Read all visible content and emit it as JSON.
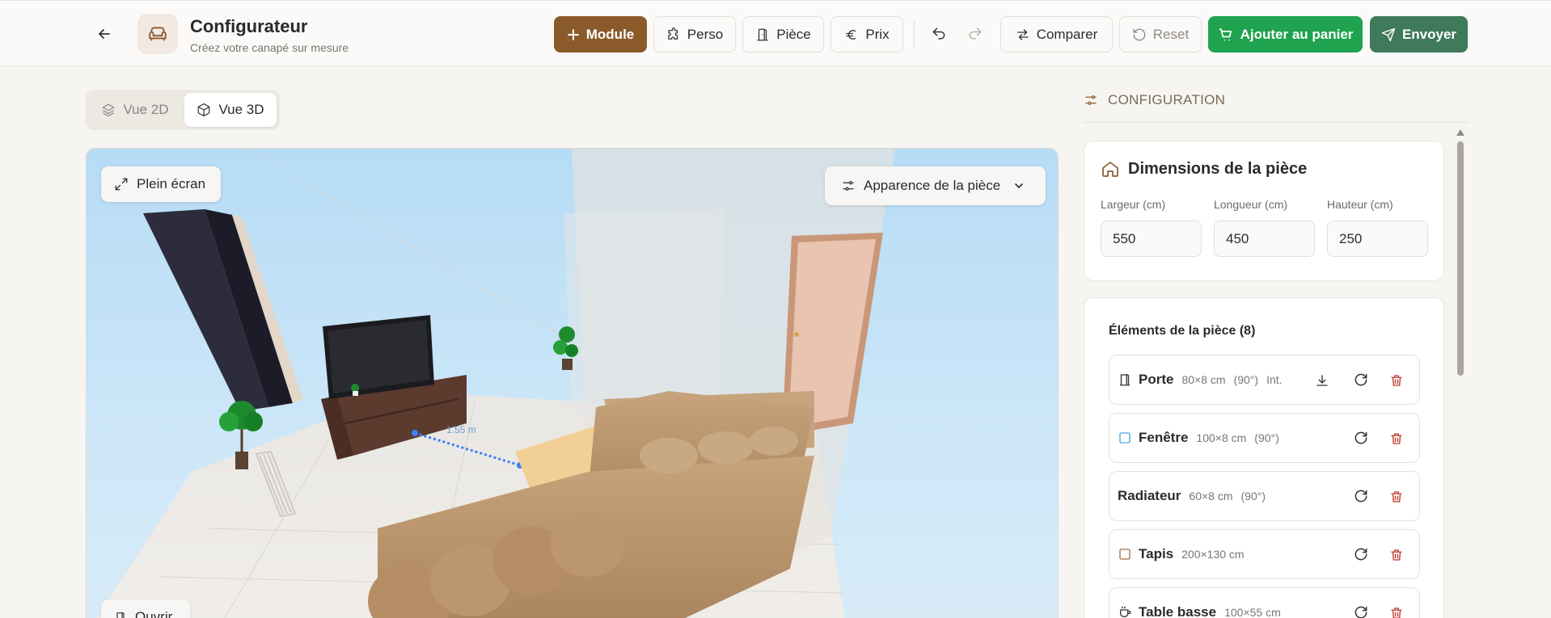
{
  "header": {
    "title": "Configurateur",
    "subtitle": "Créez votre canapé sur mesure",
    "module_label": "Module",
    "perso_label": "Perso",
    "piece_label": "Pièce",
    "prix_label": "Prix",
    "comparer_label": "Comparer",
    "reset_label": "Reset",
    "cart_label": "Ajouter au panier",
    "send_label": "Envoyer",
    "icons": [
      "arrow-left-icon",
      "sofa-icon",
      "plus-icon",
      "puzzle-icon",
      "door-icon",
      "euro-icon",
      "undo-icon",
      "redo-icon",
      "swap-icon",
      "reset-icon",
      "cart-icon",
      "send-icon"
    ]
  },
  "view_toggle": {
    "view_2d": "Vue 2D",
    "view_3d": "Vue 3D",
    "active": "Vue 3D"
  },
  "viewport": {
    "fullscreen_label": "Plein écran",
    "appearance_label": "Apparence de la pièce",
    "open_label": "Ouvrir",
    "measurement_label": "1.55 m"
  },
  "config": {
    "heading": "CONFIGURATION",
    "dimensions": {
      "title": "Dimensions de la pièce",
      "largeur_label": "Largeur (cm)",
      "largeur_value": "550",
      "longueur_label": "Longueur (cm)",
      "longueur_value": "450",
      "hauteur_label": "Hauteur (cm)",
      "hauteur_value": "250"
    },
    "elements": {
      "title": "Éléments de la pièce (8)",
      "items": [
        {
          "name": "Porte",
          "size": "80×8 cm",
          "angle": "(90°)",
          "extra": "Int.",
          "icon": "door-icon"
        },
        {
          "name": "Fenêtre",
          "size": "100×8 cm",
          "angle": "(90°)",
          "icon": "window-icon"
        },
        {
          "name": "Radiateur",
          "size": "60×8 cm",
          "angle": "(90°)"
        },
        {
          "name": "Tapis",
          "size": "200×130 cm",
          "icon": "rug-icon"
        },
        {
          "name": "Table basse",
          "size": "100×55 cm",
          "icon": "cup-icon"
        }
      ]
    }
  },
  "colors": {
    "brand_brown": "#8b5a2b",
    "cart_green": "#1fa34e",
    "send_green": "#3f7a5a",
    "delete_red": "#c0392b"
  }
}
